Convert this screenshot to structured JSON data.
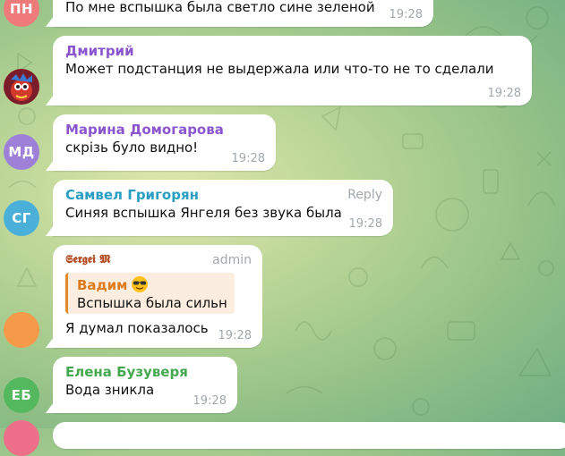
{
  "colors": {
    "avatar_pn": "#ee7a7a",
    "avatar_md": "#9f80d8",
    "avatar_sg": "#4ab0d8",
    "avatar_sergei": "#f59a4b",
    "avatar_eb": "#54b85f",
    "avatar_partial": "#ee6f8a",
    "name_dmitry": "#8a55cf",
    "name_marina": "#8a55cf",
    "name_samvel": "#2a9ec2",
    "name_sergei": "#b24a1e",
    "name_elena": "#44a84e"
  },
  "messages": [
    {
      "avatar_initials": "ПН",
      "text": "По мне  вспышка была светло сине зеленой",
      "time": "19:28"
    },
    {
      "sender": "Дмитрий",
      "avatar_icon": "cartoon-avatar-icon",
      "text": "Может подстанция не выдержала или что-то не то сделали",
      "time": "19:28"
    },
    {
      "sender": "Марина Домогарова",
      "avatar_initials": "МД",
      "text": "скрізь було видно!",
      "time": "19:28"
    },
    {
      "sender": "Самвел Григорян",
      "avatar_initials": "СГ",
      "text": "Синяя вспышка Янгеля без звука была",
      "time": "19:28",
      "action": "Reply"
    },
    {
      "sender": "𝕾𝖊𝖗𝖌𝖊𝖎 𝕸",
      "badge": "admin",
      "quote": {
        "name": "Вадим",
        "emoji": "smiling-face-with-sunglasses-icon",
        "text": "Вспышка была сильна..."
      },
      "text": "Я думал показалось",
      "time": "19:28"
    },
    {
      "sender": "Елена Бузуверя",
      "avatar_initials": "ЕБ",
      "text": "Вода зникла",
      "time": "19:28"
    }
  ]
}
